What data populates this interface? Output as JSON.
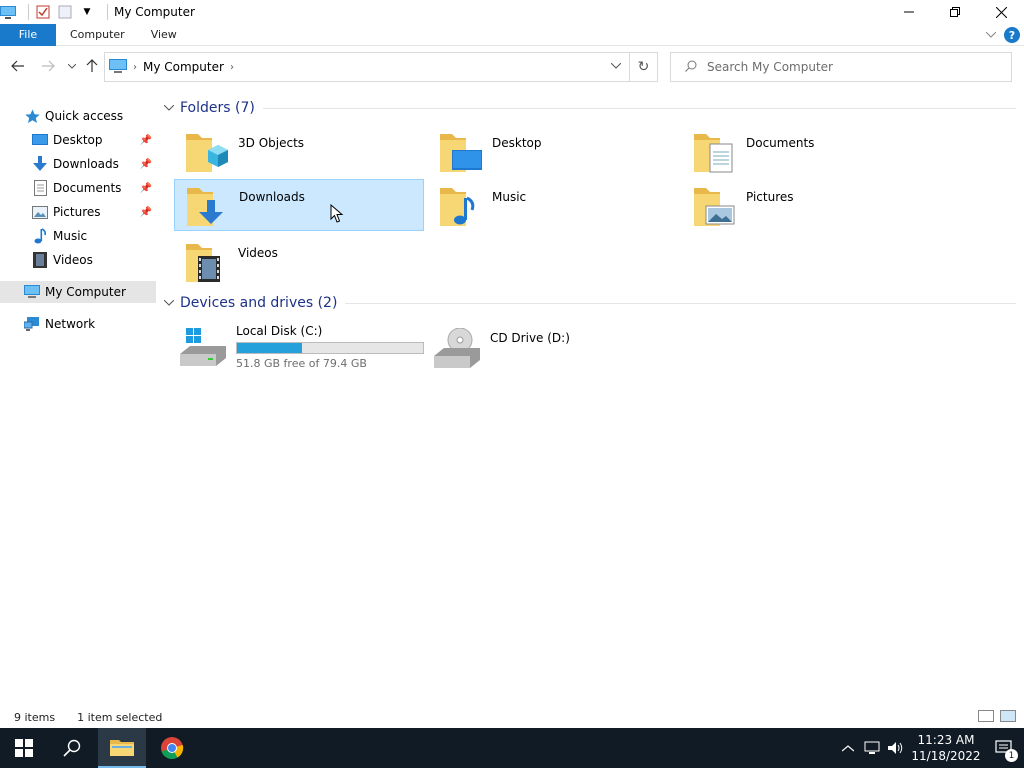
{
  "window": {
    "title": "My Computer"
  },
  "ribbon": {
    "file": "File",
    "computer": "Computer",
    "view": "View",
    "help": "?"
  },
  "address": {
    "crumb": "My Computer",
    "search_placeholder": "Search My Computer"
  },
  "nav": {
    "quick_access": "Quick access",
    "items": [
      {
        "label": "Desktop",
        "pinned": true
      },
      {
        "label": "Downloads",
        "pinned": true
      },
      {
        "label": "Documents",
        "pinned": true
      },
      {
        "label": "Pictures",
        "pinned": true
      },
      {
        "label": "Music",
        "pinned": false
      },
      {
        "label": "Videos",
        "pinned": false
      }
    ],
    "my_computer": "My Computer",
    "network": "Network"
  },
  "content": {
    "folders_header": "Folders (7)",
    "folders": [
      {
        "label": "3D Objects",
        "selected": false
      },
      {
        "label": "Desktop",
        "selected": false
      },
      {
        "label": "Documents",
        "selected": false
      },
      {
        "label": "Downloads",
        "selected": true
      },
      {
        "label": "Music",
        "selected": false
      },
      {
        "label": "Pictures",
        "selected": false
      },
      {
        "label": "Videos",
        "selected": false
      }
    ],
    "devices_header": "Devices and drives (2)",
    "drives": [
      {
        "label": "Local Disk (C:)",
        "free": "51.8 GB free of 79.4 GB",
        "used_fraction": 0.35
      },
      {
        "label": "CD Drive (D:)"
      }
    ]
  },
  "status": {
    "items": "9 items",
    "selected": "1 item selected"
  },
  "taskbar": {
    "time": "11:23 AM",
    "date": "11/18/2022",
    "notifications": "1"
  },
  "colors": {
    "accent": "#1979ca",
    "selection": "#cce8ff",
    "taskbar": "#101b26",
    "header": "#1e3287"
  }
}
